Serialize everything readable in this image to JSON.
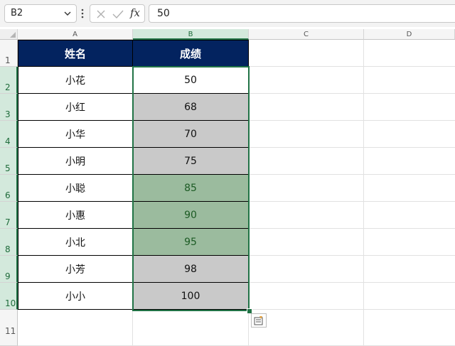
{
  "formula_bar": {
    "name_box": "B2",
    "fx_label": "fx",
    "formula_value": "50"
  },
  "columns": [
    "A",
    "B",
    "C",
    "D"
  ],
  "rows": [
    "1",
    "2",
    "3",
    "4",
    "5",
    "6",
    "7",
    "8",
    "9",
    "10",
    "11"
  ],
  "table": {
    "headers": [
      "姓名",
      "成绩"
    ],
    "records": [
      {
        "name": "小花",
        "score": "50",
        "fill": "white"
      },
      {
        "name": "小红",
        "score": "68",
        "fill": "gray"
      },
      {
        "name": "小华",
        "score": "70",
        "fill": "gray"
      },
      {
        "name": "小明",
        "score": "75",
        "fill": "gray"
      },
      {
        "name": "小聪",
        "score": "85",
        "fill": "green"
      },
      {
        "name": "小惠",
        "score": "90",
        "fill": "green"
      },
      {
        "name": "小北",
        "score": "95",
        "fill": "green"
      },
      {
        "name": "小芳",
        "score": "98",
        "fill": "gray"
      },
      {
        "name": "小小",
        "score": "100",
        "fill": "gray"
      }
    ]
  },
  "colors": {
    "header_fill": "#03235f",
    "header_text": "#ffffff",
    "gray_fill": "#c9c9c9",
    "green_fill": "#9bbb9e",
    "green_text": "#1c5b24",
    "selection": "#217346"
  }
}
